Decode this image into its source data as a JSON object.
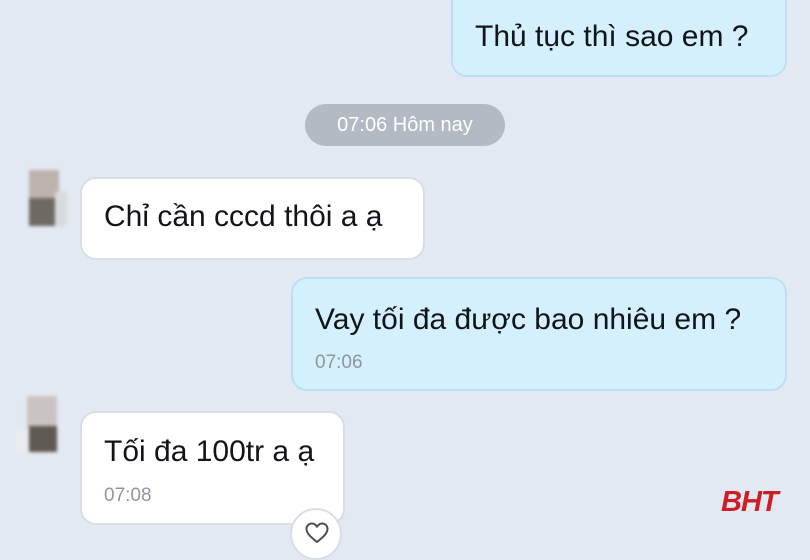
{
  "messages": [
    {
      "direction": "outgoing",
      "text": "Thủ tục thì sao em ?",
      "time": ""
    },
    {
      "direction": "incoming",
      "text": "Chỉ cần cccd thôi a ạ",
      "time": ""
    },
    {
      "direction": "outgoing",
      "text": "Vay tối đa được bao nhiêu em ?",
      "time": "07:06"
    },
    {
      "direction": "incoming",
      "text": "Tối đa 100tr a ạ",
      "time": "07:08"
    }
  ],
  "divider": {
    "label": "07:06 Hôm nay"
  },
  "icons": {
    "reaction": "heart-icon",
    "avatar": "avatar-icon"
  },
  "watermark": {
    "text": "BHT",
    "color": "#cf1d26"
  },
  "colors": {
    "background": "#e3e9f2",
    "outgoing_bubble": "#d5f0fd",
    "incoming_bubble": "#ffffff",
    "timestamp_pill": "#b4bac3"
  }
}
